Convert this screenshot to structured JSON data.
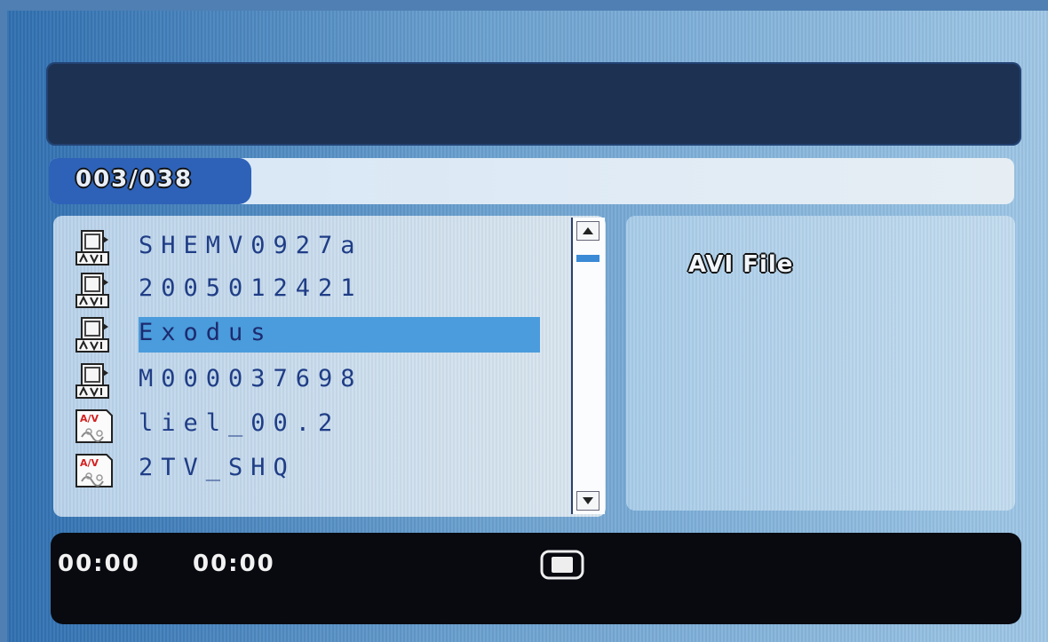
{
  "header": {
    "title": ""
  },
  "counter": {
    "text": "003/038"
  },
  "file_list": {
    "items": [
      {
        "label": "SHEMV0927a",
        "icon": "avi-file-icon",
        "selected": false
      },
      {
        "label": "2005012421",
        "icon": "avi-file-icon",
        "selected": false
      },
      {
        "label": "Exodus",
        "icon": "avi-file-icon",
        "selected": true
      },
      {
        "label": "M000037698",
        "icon": "avi-file-icon",
        "selected": false
      },
      {
        "label": "liel_00.2",
        "icon": "av-file-icon",
        "selected": false
      },
      {
        "label": "2TV_SHQ",
        "icon": "av-file-icon",
        "selected": false
      }
    ]
  },
  "info": {
    "file_type": "AVI File"
  },
  "status": {
    "elapsed": "00:00",
    "total": "00:00",
    "state_icon": "stop-icon"
  },
  "colors": {
    "highlight": "#4a9cdc",
    "list_text": "#1f3d86",
    "counter_tab": "#2e62b8",
    "status_bg": "#080a10"
  }
}
